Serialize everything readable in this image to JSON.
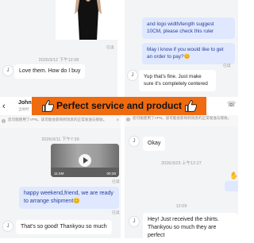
{
  "top_left": {
    "read_label": "已读",
    "timestamp": "2026/3/12 下午12:08",
    "avatar": "J",
    "message": "Love them. How do I buy"
  },
  "top_right": {
    "msg1": "and logo width/length suggest 10CM, please check this ruler",
    "msg2": "May i know if you would like to get an order to pay?😊",
    "read_label": "已读",
    "avatar": "J",
    "msg3": "Yup that's fine. Just make sure it's completely centered"
  },
  "banner": {
    "text": "Perfect service and product",
    "icon_left": "thumbs-up-icon",
    "icon_right": "thumbs-up-icon",
    "color": "#f06a10"
  },
  "header": {
    "back_icon": "‹",
    "contact_name": "John",
    "contact_sub": "当地时",
    "phone_icon": "☏"
  },
  "notice_left": {
    "text": "您可能使用了VPN。该可能会影响到消息的正常发送与接收。",
    "close": "×"
  },
  "notice_right": {
    "text": "您可能使用了VPN。该可能会影响到消息的正常发送与接收。"
  },
  "bottom_left": {
    "timestamp": "2026/3/11 下午7:39",
    "video_size": "11.5M",
    "video_duration": "00:26",
    "video_read": "已读",
    "msg1": "happy weekend,friend, we are ready to arrange shipment😊",
    "msg1_read": "已读",
    "avatar": "J",
    "msg2": "That's so good! Thankyou so much"
  },
  "bottom_right": {
    "avatar_top": "J",
    "msg_okay": "Okay",
    "timestamp1": "2026/3/23 上午12:27",
    "timestamp2": "12:09",
    "avatar_bottom": "J",
    "msg_final": "Hey! Just received the shirts. Thankyou so much they are perfect"
  }
}
